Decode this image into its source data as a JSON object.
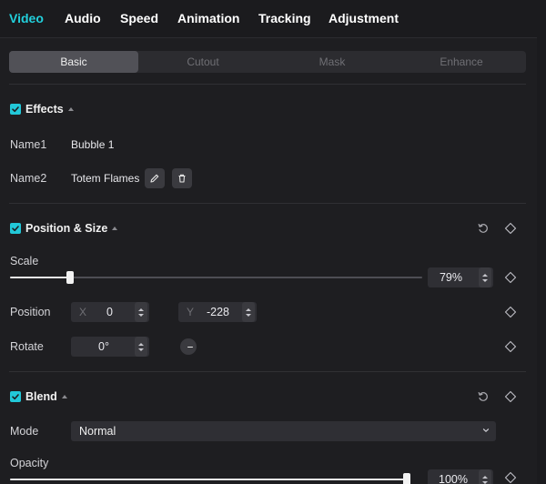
{
  "top_tabs": [
    {
      "label": "Video",
      "active": true
    },
    {
      "label": "Audio",
      "active": false
    },
    {
      "label": "Speed",
      "active": false
    },
    {
      "label": "Animation",
      "active": false
    },
    {
      "label": "Tracking",
      "active": false
    },
    {
      "label": "Adjustment",
      "active": false
    }
  ],
  "sub_tabs": [
    {
      "label": "Basic",
      "active": true
    },
    {
      "label": "Cutout",
      "active": false
    },
    {
      "label": "Mask",
      "active": false
    },
    {
      "label": "Enhance",
      "active": false
    }
  ],
  "effects": {
    "title": "Effects",
    "enabled": true,
    "name1_label": "Name1",
    "name1_value": "Bubble 1",
    "name2_label": "Name2",
    "name2_value": "Totem Flames"
  },
  "position_size": {
    "title": "Position & Size",
    "enabled": true,
    "scale_label": "Scale",
    "scale_value": "79%",
    "scale_fraction": 0.145,
    "position_label": "Position",
    "x_prefix": "X",
    "x_value": "0",
    "y_prefix": "Y",
    "y_value": "-228",
    "rotate_label": "Rotate",
    "rotate_value": "0°"
  },
  "blend": {
    "title": "Blend",
    "enabled": true,
    "mode_label": "Mode",
    "mode_value": "Normal",
    "opacity_label": "Opacity",
    "opacity_value": "100%",
    "opacity_fraction": 1.0
  },
  "colors": {
    "accent": "#22d0dc",
    "background": "#1e1e21"
  },
  "icons": {
    "edit": "pencil-icon",
    "delete": "trash-icon",
    "reset": "reset-icon",
    "keyframe": "diamond-keyframe-icon",
    "check": "checkmark-icon"
  }
}
